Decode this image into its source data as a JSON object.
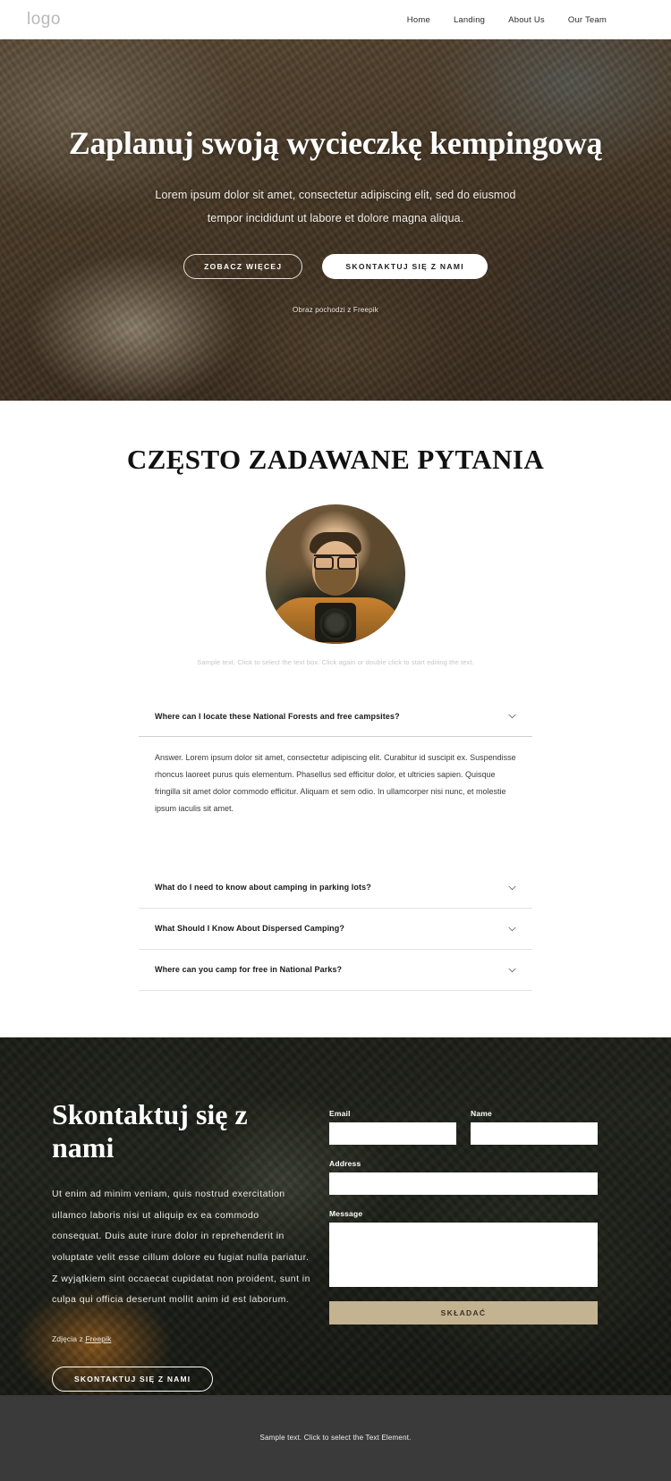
{
  "header": {
    "logo": "logo",
    "nav": [
      {
        "label": "Home"
      },
      {
        "label": "Landing"
      },
      {
        "label": "About Us"
      },
      {
        "label": "Our Team"
      }
    ]
  },
  "hero": {
    "title": "Zaplanuj swoją wycieczkę kempingową",
    "subtitle": "Lorem ipsum dolor sit amet, consectetur adipiscing elit, sed do eiusmod tempor incididunt ut labore et dolore magna aliqua.",
    "primary_button": "ZOBACZ WIĘCEJ",
    "secondary_button": "SKONTAKTUJ SIĘ Z NAMI",
    "credit": "Obraz pochodzi z Freepik"
  },
  "faq": {
    "title": "CZĘSTO ZADAWANE PYTANIA",
    "avatar_alt": "photographer-portrait",
    "sample_note": "Sample text. Click to select the text box. Click again or double click to start editing the text.",
    "items": [
      {
        "question": "Where can I locate these National Forests and free campsites?",
        "answer": "Answer. Lorem ipsum dolor sit amet, consectetur adipiscing elit. Curabitur id suscipit ex. Suspendisse rhoncus laoreet purus quis elementum. Phasellus sed efficitur dolor, et ultricies sapien. Quisque fringilla sit amet dolor commodo efficitur. Aliquam et sem odio. In ullamcorper nisi nunc, et molestie ipsum iaculis sit amet.",
        "open": true
      },
      {
        "question": "What do I need to know about camping in parking lots?",
        "answer": "",
        "open": false
      },
      {
        "question": "What Should I Know About Dispersed Camping?",
        "answer": "",
        "open": false
      },
      {
        "question": "Where can you camp for free in National Parks?",
        "answer": "",
        "open": false
      }
    ]
  },
  "contact": {
    "title": "Skontaktuj się z nami",
    "text": "Ut enim ad minim veniam, quis nostrud exercitation ullamco laboris nisi ut aliquip ex ea commodo consequat. Duis aute irure dolor in reprehenderit in voluptate velit esse cillum dolore eu fugiat nulla pariatur. Z wyjątkiem sint occaecat cupidatat non proident, sunt in culpa qui officia deserunt mollit anim id est laborum.",
    "credit_prefix": "Zdjęcia z ",
    "credit_link": "Freepik",
    "button": "SKONTAKTUJ SIĘ Z NAMI",
    "form": {
      "email_label": "Email",
      "email_value": "",
      "email_placeholder": "",
      "name_label": "Name",
      "name_value": "",
      "name_placeholder": "",
      "address_label": "Address",
      "address_value": "",
      "address_placeholder": "",
      "message_label": "Message",
      "message_value": "",
      "message_placeholder": "",
      "submit_label": "SKŁADAĆ",
      "submit_color": "#c3b391"
    }
  },
  "footer": {
    "text": "Sample text. Click to select the Text Element."
  }
}
